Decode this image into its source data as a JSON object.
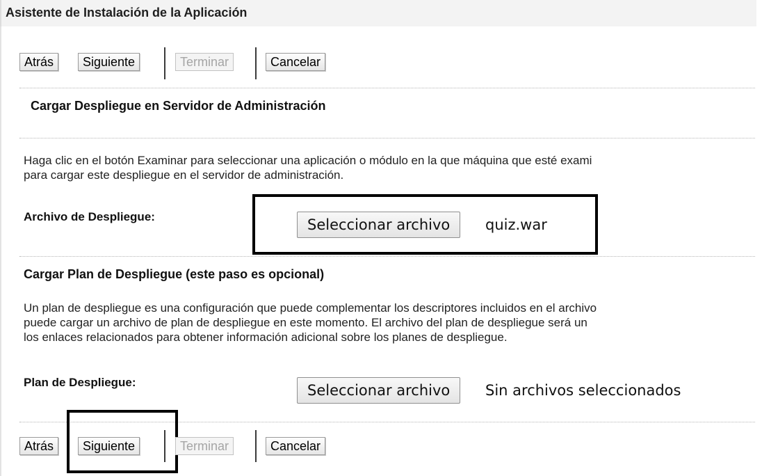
{
  "window": {
    "title": "Asistente de Instalación de la Aplicación"
  },
  "toolbar_top": {
    "back": "Atrás",
    "next": "Siguiente",
    "finish": "Terminar",
    "cancel": "Cancelar"
  },
  "section_upload": {
    "heading": "Cargar Despliegue en Servidor de Administración",
    "line1": "Haga clic en el botón Examinar para seleccionar una aplicación o módulo en la que máquina que esté exami",
    "line2": "para cargar este despliegue en el servidor de administración.",
    "label": "Archivo de Despliegue:",
    "button": "Seleccionar archivo",
    "file": "quiz.war"
  },
  "section_plan": {
    "heading": "Cargar Plan de Despliegue (este paso es opcional)",
    "line1": "Un plan de despliegue es una configuración que puede complementar los descriptores incluidos en el archivo",
    "line2": "puede cargar un archivo de plan de despliegue en este momento. El archivo del plan de despliegue será un",
    "line3": "los enlaces relacionados para obtener información adicional sobre los planes de despliegue.",
    "label": "Plan de Despliegue:",
    "button": "Seleccionar archivo",
    "file": "Sin archivos seleccionados"
  },
  "toolbar_bottom": {
    "back": "Atrás",
    "next": "Siguiente",
    "finish": "Terminar",
    "cancel": "Cancelar"
  }
}
